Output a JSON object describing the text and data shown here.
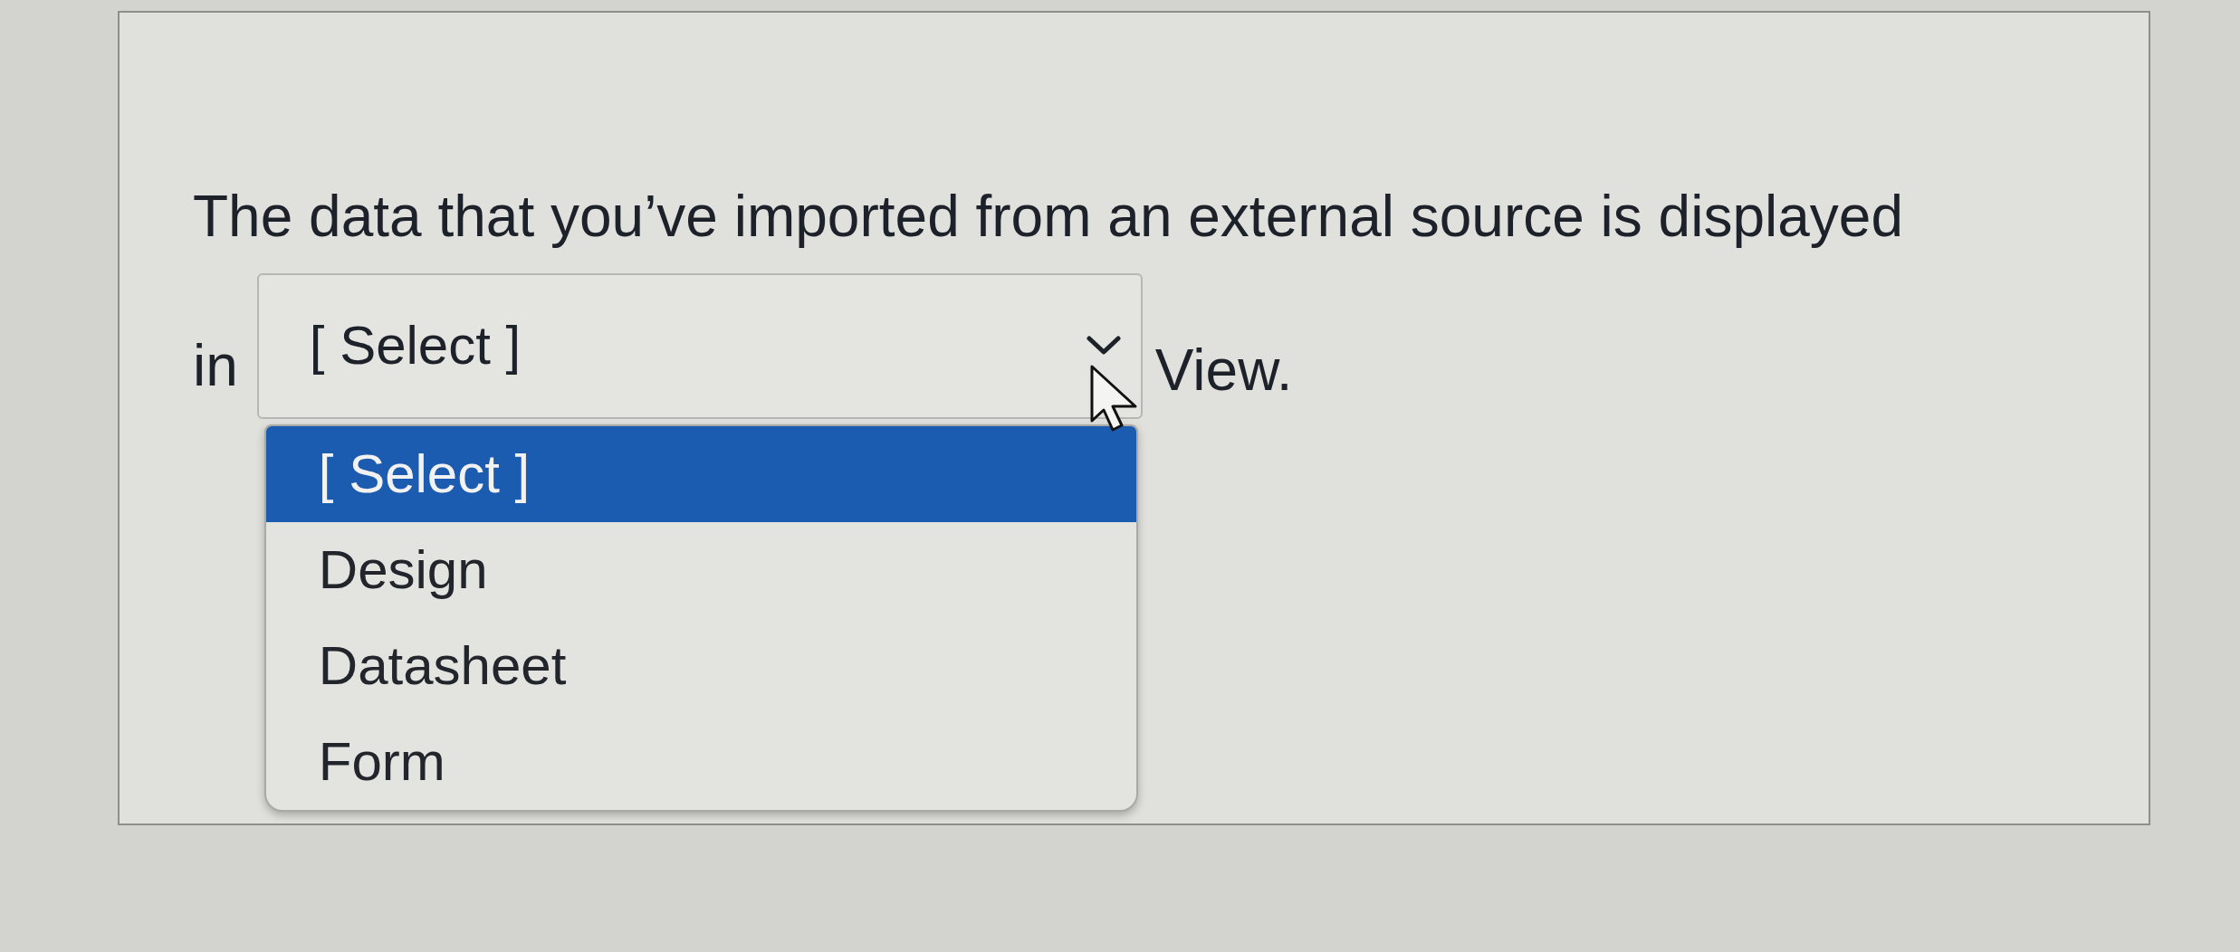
{
  "question": {
    "text_before": "The data that you’ve imported from an external source is displayed",
    "text_in": "in",
    "text_after": "View."
  },
  "dropdown": {
    "value": "[ Select ]",
    "expanded": true,
    "options": [
      {
        "label": "[ Select ]",
        "selected": true
      },
      {
        "label": "Design",
        "selected": false
      },
      {
        "label": "Datasheet",
        "selected": false
      },
      {
        "label": "Form",
        "selected": false
      }
    ]
  }
}
